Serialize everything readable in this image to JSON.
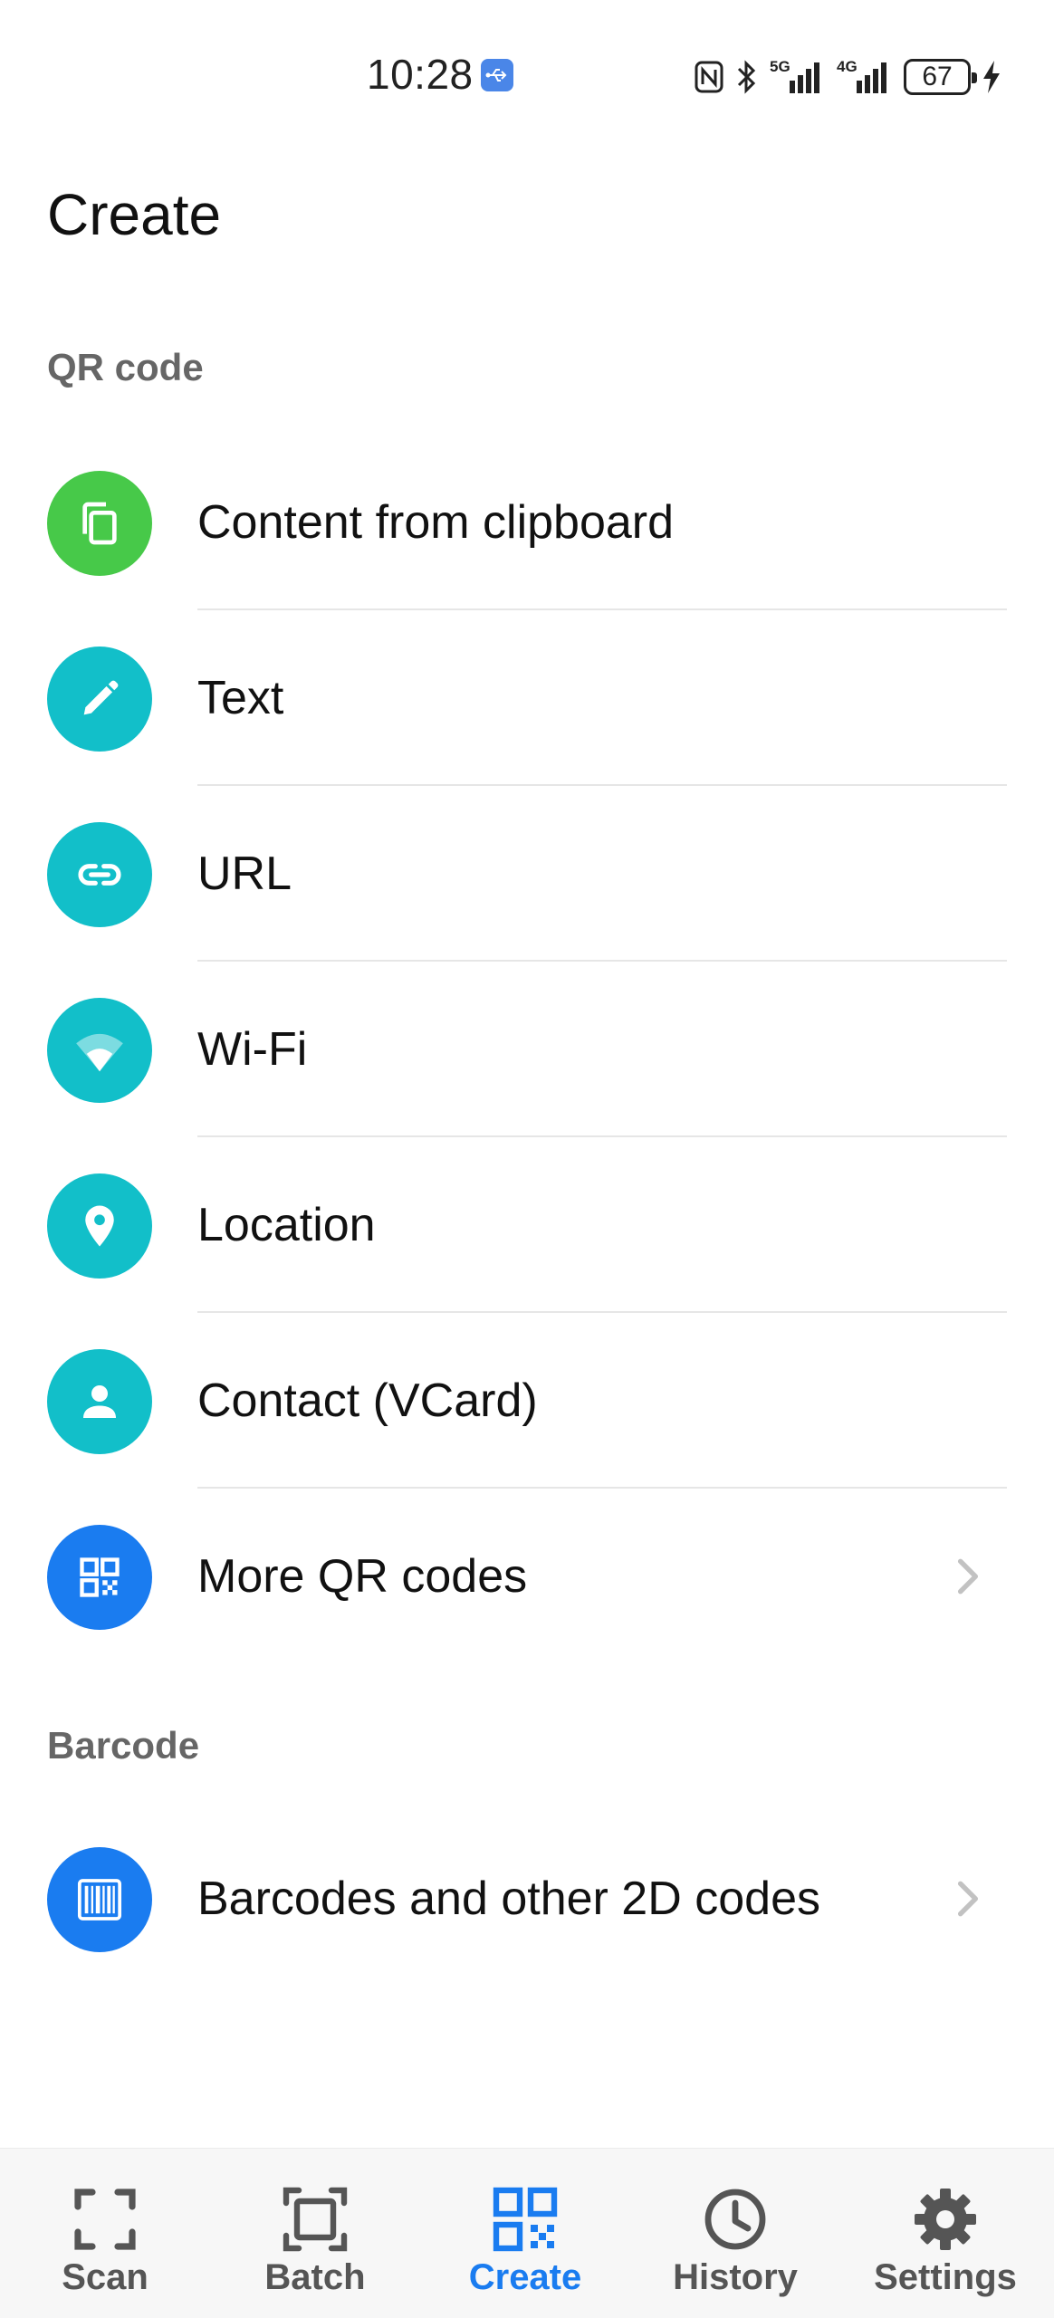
{
  "status_bar": {
    "time": "10:28",
    "battery": "67"
  },
  "header": {
    "title": "Create"
  },
  "sections": {
    "qr": {
      "label": "QR code"
    },
    "barcode": {
      "label": "Barcode"
    }
  },
  "qr_items": [
    {
      "label": "Content from clipboard",
      "icon": "clipboard-copy-icon",
      "color": "#47c949"
    },
    {
      "label": "Text",
      "icon": "pencil-icon",
      "color": "#12bfc9"
    },
    {
      "label": "URL",
      "icon": "link-icon",
      "color": "#12bfc9"
    },
    {
      "label": "Wi-Fi",
      "icon": "wifi-icon",
      "color": "#12bfc9"
    },
    {
      "label": "Location",
      "icon": "location-pin-icon",
      "color": "#12bfc9"
    },
    {
      "label": "Contact (VCard)",
      "icon": "person-icon",
      "color": "#12bfc9"
    },
    {
      "label": "More QR codes",
      "icon": "qr-code-icon",
      "color": "#1a7cf0"
    }
  ],
  "barcode_items": [
    {
      "label": "Barcodes and other 2D codes",
      "icon": "barcode-icon",
      "color": "#1a7cf0"
    }
  ],
  "nav": {
    "active": "Create",
    "accent": "#1a7cf0",
    "items": [
      {
        "label": "Scan",
        "icon": "scan-frame-icon"
      },
      {
        "label": "Batch",
        "icon": "batch-frame-icon"
      },
      {
        "label": "Create",
        "icon": "qr-code-icon"
      },
      {
        "label": "History",
        "icon": "clock-icon"
      },
      {
        "label": "Settings",
        "icon": "gear-icon"
      }
    ]
  }
}
